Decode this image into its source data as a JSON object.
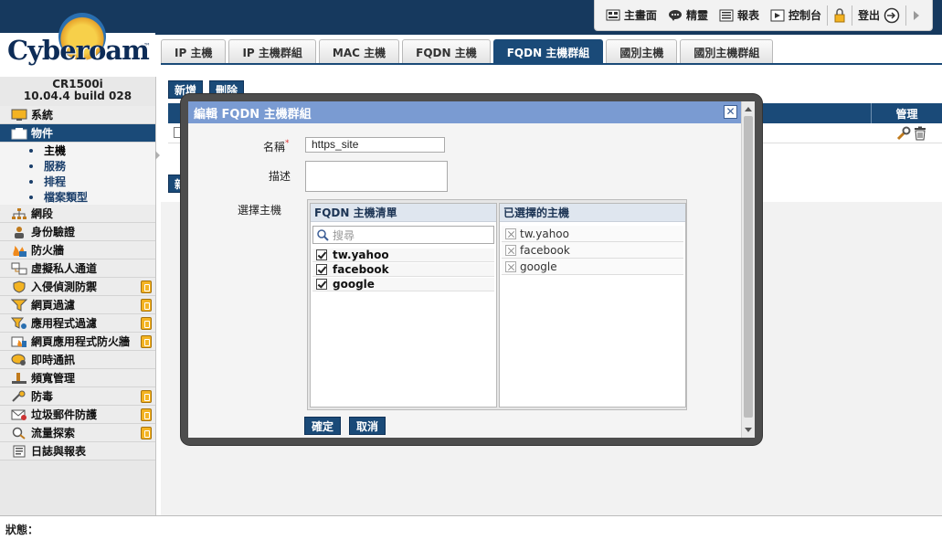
{
  "header": {
    "links": [
      {
        "label": "主畫面",
        "icon": "dashboard-icon"
      },
      {
        "label": "精靈",
        "icon": "wizard-icon"
      },
      {
        "label": "報表",
        "icon": "report-icon"
      },
      {
        "label": "控制台",
        "icon": "console-icon"
      },
      {
        "label": "登出",
        "icon": "logout-icon"
      }
    ]
  },
  "logo": {
    "text": "Cyberoam",
    "tm": "™"
  },
  "device": {
    "model": "CR1500i",
    "version": "10.04.4 build 028"
  },
  "sidebar": {
    "items": [
      {
        "label": "系統",
        "locked": false
      },
      {
        "label": "物件",
        "locked": false,
        "active": true
      },
      {
        "label": "網段",
        "locked": false
      },
      {
        "label": "身份驗證",
        "locked": false
      },
      {
        "label": "防火牆",
        "locked": false
      },
      {
        "label": "虛擬私人通道",
        "locked": false
      },
      {
        "label": "入侵偵測防禦",
        "locked": true
      },
      {
        "label": "網頁過濾",
        "locked": true
      },
      {
        "label": "應用程式過濾",
        "locked": true
      },
      {
        "label": "網頁應用程式防火牆",
        "locked": true
      },
      {
        "label": "即時通訊",
        "locked": false
      },
      {
        "label": "頻寬管理",
        "locked": false
      },
      {
        "label": "防毒",
        "locked": true
      },
      {
        "label": "垃圾郵件防護",
        "locked": true
      },
      {
        "label": "流量探索",
        "locked": true
      },
      {
        "label": "日誌與報表",
        "locked": false
      }
    ],
    "subitems": [
      "主機",
      "服務",
      "排程",
      "檔案類型"
    ]
  },
  "tabs": [
    {
      "label": "IP 主機"
    },
    {
      "label": "IP 主機群組"
    },
    {
      "label": "MAC 主機"
    },
    {
      "label": "FQDN 主機"
    },
    {
      "label": "FQDN 主機群組",
      "active": true
    },
    {
      "label": "國別主機"
    },
    {
      "label": "國別主機群組"
    }
  ],
  "toolbar": {
    "add_label": "新增",
    "delete_label": "刪除",
    "add_short": "新"
  },
  "table": {
    "manage_header": "管理"
  },
  "dialog": {
    "title": "編輯 FQDN 主機群組",
    "close": "✕",
    "name_label": "名稱",
    "required_mark": "*",
    "name_value": "https_site",
    "desc_label": "描述",
    "select_label": "選擇主機",
    "left_header": "FQDN 主機清單",
    "search_placeholder": "搜尋",
    "left_items": [
      "tw.yahoo",
      "facebook",
      "google"
    ],
    "right_header": "已選擇的主機",
    "right_items": [
      "tw.yahoo",
      "facebook",
      "google"
    ],
    "ok_label": "確定",
    "cancel_label": "取消"
  },
  "status": {
    "label": "狀態："
  }
}
